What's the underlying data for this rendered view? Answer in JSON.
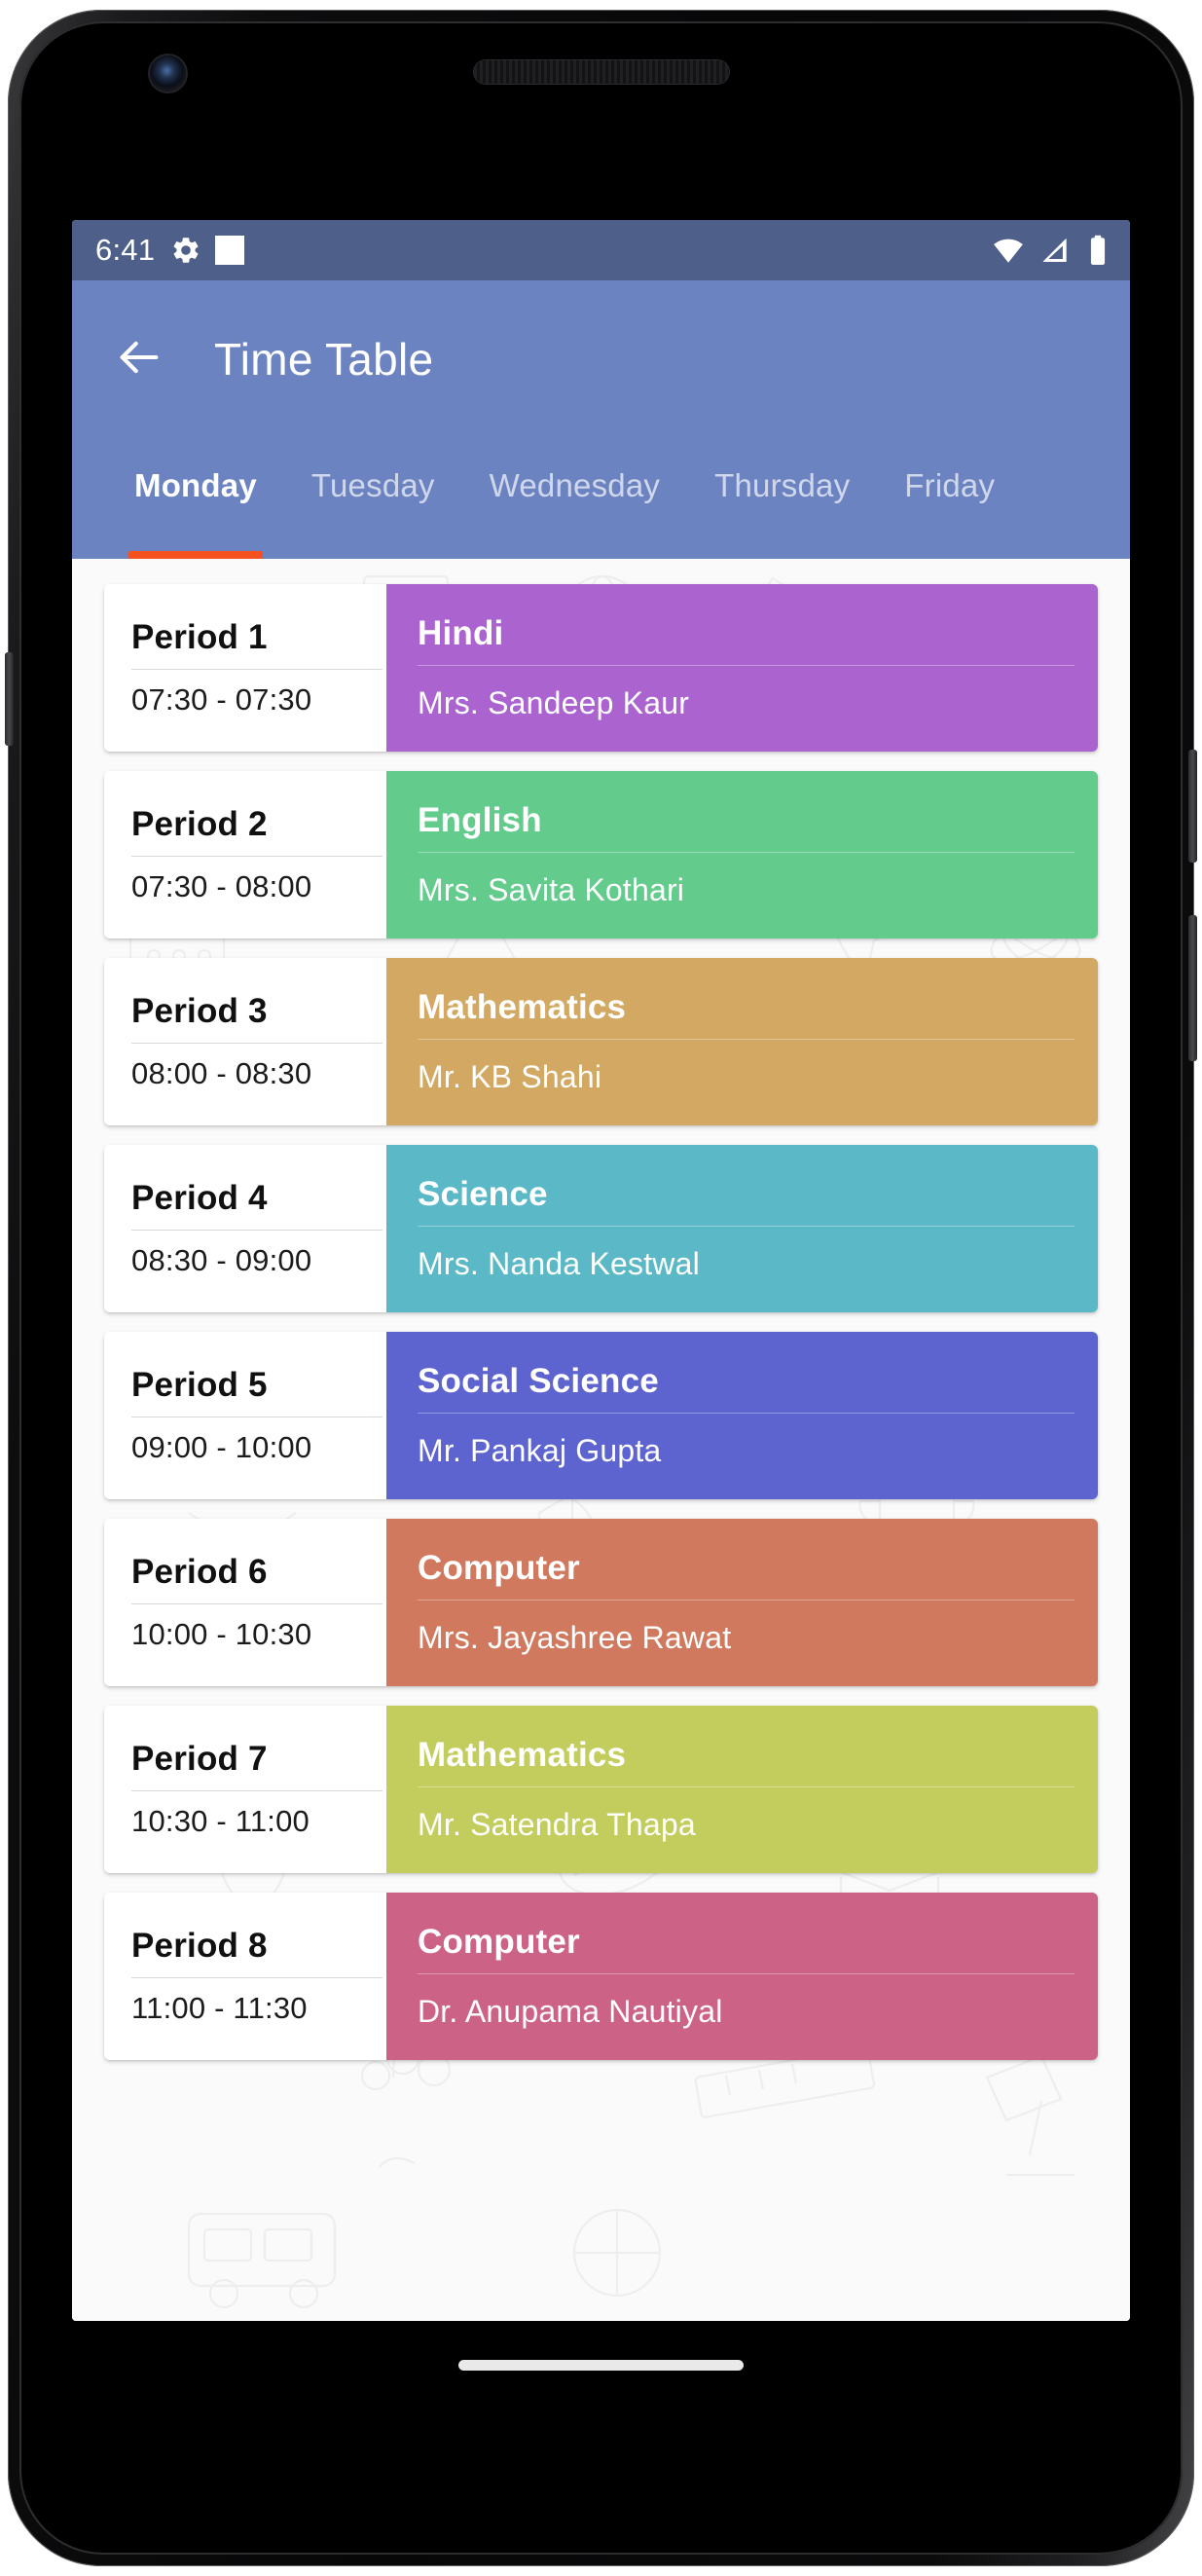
{
  "status_bar": {
    "time": "6:41",
    "icons": [
      "gear-icon",
      "notification-square-icon",
      "wifi-icon",
      "cellular-signal-icon",
      "battery-icon"
    ]
  },
  "app_bar": {
    "back_icon": "back-arrow-icon",
    "title": "Time Table"
  },
  "tabs": {
    "active_index": 0,
    "items": [
      {
        "label": "Monday"
      },
      {
        "label": "Tuesday"
      },
      {
        "label": "Wednesday"
      },
      {
        "label": "Thursday"
      },
      {
        "label": "Friday"
      }
    ]
  },
  "schedule": {
    "rows": [
      {
        "period": "Period 1",
        "time": "07:30 - 07:30",
        "subject": "Hindi",
        "teacher": "Mrs. Sandeep Kaur",
        "color": "#ab63d0"
      },
      {
        "period": "Period 2",
        "time": "07:30 - 08:00",
        "subject": "English",
        "teacher": "Mrs. Savita Kothari",
        "color": "#63cb8c"
      },
      {
        "period": "Period 3",
        "time": "08:00 - 08:30",
        "subject": "Mathematics",
        "teacher": "Mr. KB Shahi",
        "color": "#d2a862"
      },
      {
        "period": "Period 4",
        "time": "08:30 - 09:00",
        "subject": "Science",
        "teacher": "Mrs. Nanda Kestwal",
        "color": "#5bb8c6"
      },
      {
        "period": "Period 5",
        "time": "09:00 - 10:00",
        "subject": "Social Science",
        "teacher": "Mr. Pankaj Gupta",
        "color": "#5d63cf"
      },
      {
        "period": "Period 6",
        "time": "10:00 - 10:30",
        "subject": "Computer",
        "teacher": "Mrs. Jayashree Rawat",
        "color": "#d0795f"
      },
      {
        "period": "Period 7",
        "time": "10:30 - 11:00",
        "subject": "Mathematics",
        "teacher": "Mr. Satendra Thapa",
        "color": "#c2cd5e"
      },
      {
        "period": "Period 8",
        "time": "11:00 - 11:30",
        "subject": "Computer",
        "teacher": "Dr. Anupama Nautiyal",
        "color": "#cd6287"
      }
    ]
  },
  "theme": {
    "app_bar_color": "#6c83c2",
    "status_bar_color": "#4e5f89",
    "tab_indicator_color": "#f4511e",
    "content_background": "#fafafa"
  },
  "nav_bar": {
    "home_indicator": "home-gesture-indicator"
  }
}
